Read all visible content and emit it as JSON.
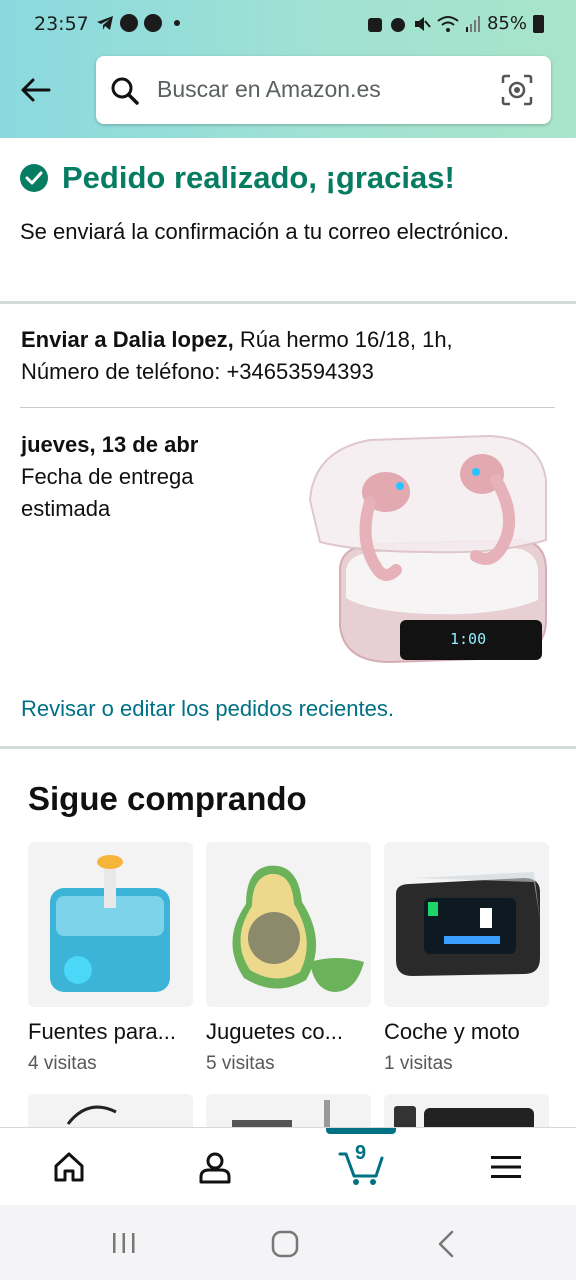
{
  "status_bar": {
    "time": "23:57",
    "battery": "85%"
  },
  "search": {
    "placeholder": "Buscar en Amazon.es"
  },
  "confirmation": {
    "title": "Pedido realizado, ¡gracias!",
    "subtitle": "Se enviará la confirmación a tu correo electrónico."
  },
  "shipping": {
    "recipient_label": "Enviar a Dalia lopez,",
    "address": " Rúa hermo 16/18, 1h,",
    "phone_line": "Número de teléfono: +34653594393"
  },
  "delivery": {
    "date": "jueves, 13 de abr",
    "label": "Fecha de entrega estimada",
    "product_display": "1:00"
  },
  "review_link": "Revisar o editar los pedidos recientes.",
  "keep_shopping": {
    "title": "Sigue comprando",
    "cards": [
      {
        "name": "Fuentes para...",
        "visits": "4 visitas"
      },
      {
        "name": "Juguetes co...",
        "visits": "5 visitas"
      },
      {
        "name": "Coche y moto",
        "visits": "1 visitas"
      }
    ]
  },
  "bottom_nav": {
    "cart_count": "9",
    "items": [
      "home-icon",
      "account-icon",
      "cart-icon",
      "menu-icon"
    ]
  },
  "colors": {
    "accent_green": "#067d62",
    "link_teal": "#007185",
    "header_gradient_start": "#8ad9df",
    "header_gradient_end": "#a9e4cb"
  }
}
